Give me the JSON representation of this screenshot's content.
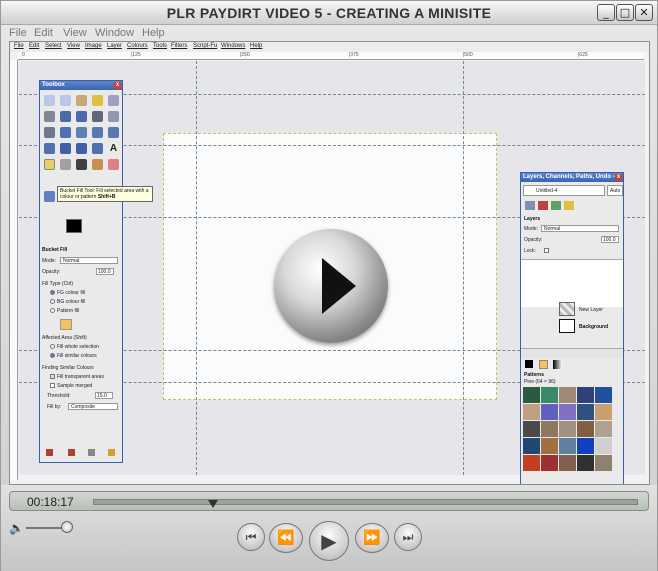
{
  "window": {
    "title": "PLR PAYDIRT VIDEO 5 - CREATING A MINISITE",
    "minimize_glyph": "_",
    "maximize_glyph": "□",
    "close_glyph": "✕"
  },
  "menu": {
    "items": [
      "File",
      "Edit",
      "View",
      "Window",
      "Help"
    ]
  },
  "gimp": {
    "menu": [
      "File",
      "Edit",
      "Select",
      "View",
      "Image",
      "Layer",
      "Colours",
      "Tools",
      "Filters",
      "Script-Fu",
      "Windows",
      "Help"
    ],
    "ruler_ticks": [
      "0",
      "|125",
      "|250",
      "|375",
      "|500",
      "|625"
    ],
    "toolbox": {
      "title": "Toolbox",
      "close": "x",
      "tooltip_line1": "Bucket Fill Tool: Fill selected area with a",
      "tooltip_line2": "colour or pattern",
      "tooltip_shortcut": "Shift+B",
      "tool_name": "Bucket Fill",
      "mode_label": "Mode:",
      "mode_value": "Normal",
      "opacity_label": "Opacity:",
      "opacity_value": "100.0",
      "fill_type_label": "Fill Type  (Ctrl)",
      "fill_types": [
        "FG colour fill",
        "BG colour fill",
        "Pattern fill"
      ],
      "affected_label": "Affected Area  (Shift)",
      "affected": [
        "Fill whole selection",
        "Fill similar colours"
      ],
      "finding_label": "Finding Similar Colours",
      "fill_transparent": "Fill transparent areas",
      "sample_merged": "Sample merged",
      "threshold_label": "Threshold:",
      "threshold_value": "15.0",
      "fill_by_label": "Fill by:",
      "fill_by_value": "Composite"
    },
    "layers_panel": {
      "title": "Layers, Channels, Paths, Undo - ...",
      "image_select": "Untitled-4",
      "auto": "Auto",
      "section": "Layers",
      "mode_label": "Mode:",
      "mode_value": "Normal",
      "opacity_label": "Opacity:",
      "opacity_value": "100.0",
      "lock_label": "Lock:",
      "layers": [
        "New Layer",
        "Background"
      ],
      "patterns_label": "Patterns",
      "pattern_name": "Pine (64 × 96)"
    }
  },
  "player": {
    "timecode": "00:18:17",
    "progress": 0.22,
    "volume_glyph": "🔈",
    "buttons": {
      "prev": "⏮",
      "rewind": "⏪",
      "play": "▶",
      "forward": "⏩",
      "next": "⏭"
    }
  },
  "colors": {
    "panel_title": "#3a63b0",
    "fg_color": "#000000",
    "bg_color": "#ffffff",
    "pattern_swatch": "#f4c060"
  }
}
